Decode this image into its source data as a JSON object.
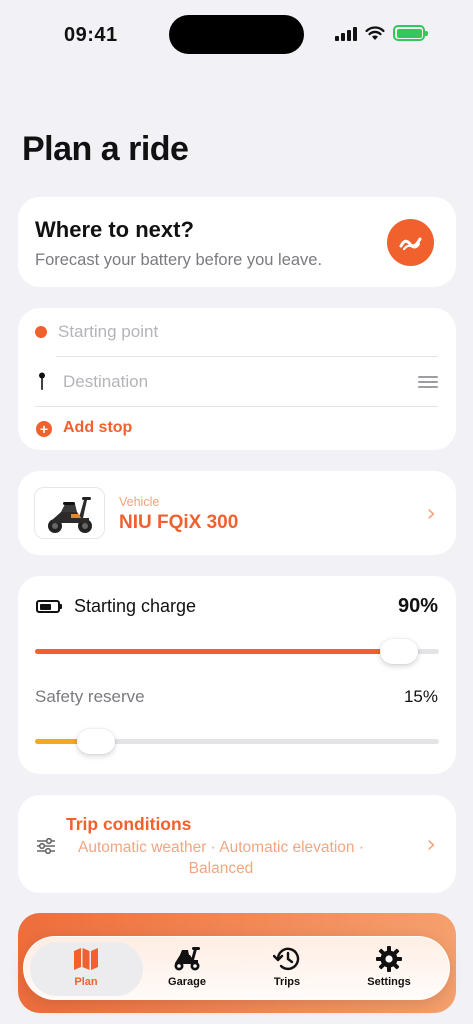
{
  "status_bar": {
    "time": "09:41"
  },
  "page_title": "Plan a ride",
  "hero": {
    "title": "Where to next?",
    "subtitle": "Forecast your battery before you leave.",
    "icon": "forecast-wave-icon"
  },
  "route": {
    "start_placeholder": "Starting point",
    "destination_placeholder": "Destination",
    "add_stop_label": "Add stop"
  },
  "vehicle": {
    "label": "Vehicle",
    "name": "NIU FQiX 300"
  },
  "charge": {
    "starting_label": "Starting charge",
    "starting_value": "90%",
    "starting_fraction": 0.9,
    "reserve_label": "Safety reserve",
    "reserve_value": "15%",
    "reserve_fraction": 0.15
  },
  "trip_conditions": {
    "title": "Trip conditions",
    "subtitle": "Automatic weather · Automatic elevation · Balanced"
  },
  "tabs": [
    {
      "label": "Plan",
      "icon": "map-icon",
      "active": true
    },
    {
      "label": "Garage",
      "icon": "scooter-icon",
      "active": false
    },
    {
      "label": "Trips",
      "icon": "history-icon",
      "active": false
    },
    {
      "label": "Settings",
      "icon": "gear-icon",
      "active": false
    }
  ],
  "colors": {
    "accent": "#f0612e",
    "accent_light": "#f3a682",
    "reserve_track": "#f5a623",
    "battery_status": "#34c759"
  }
}
